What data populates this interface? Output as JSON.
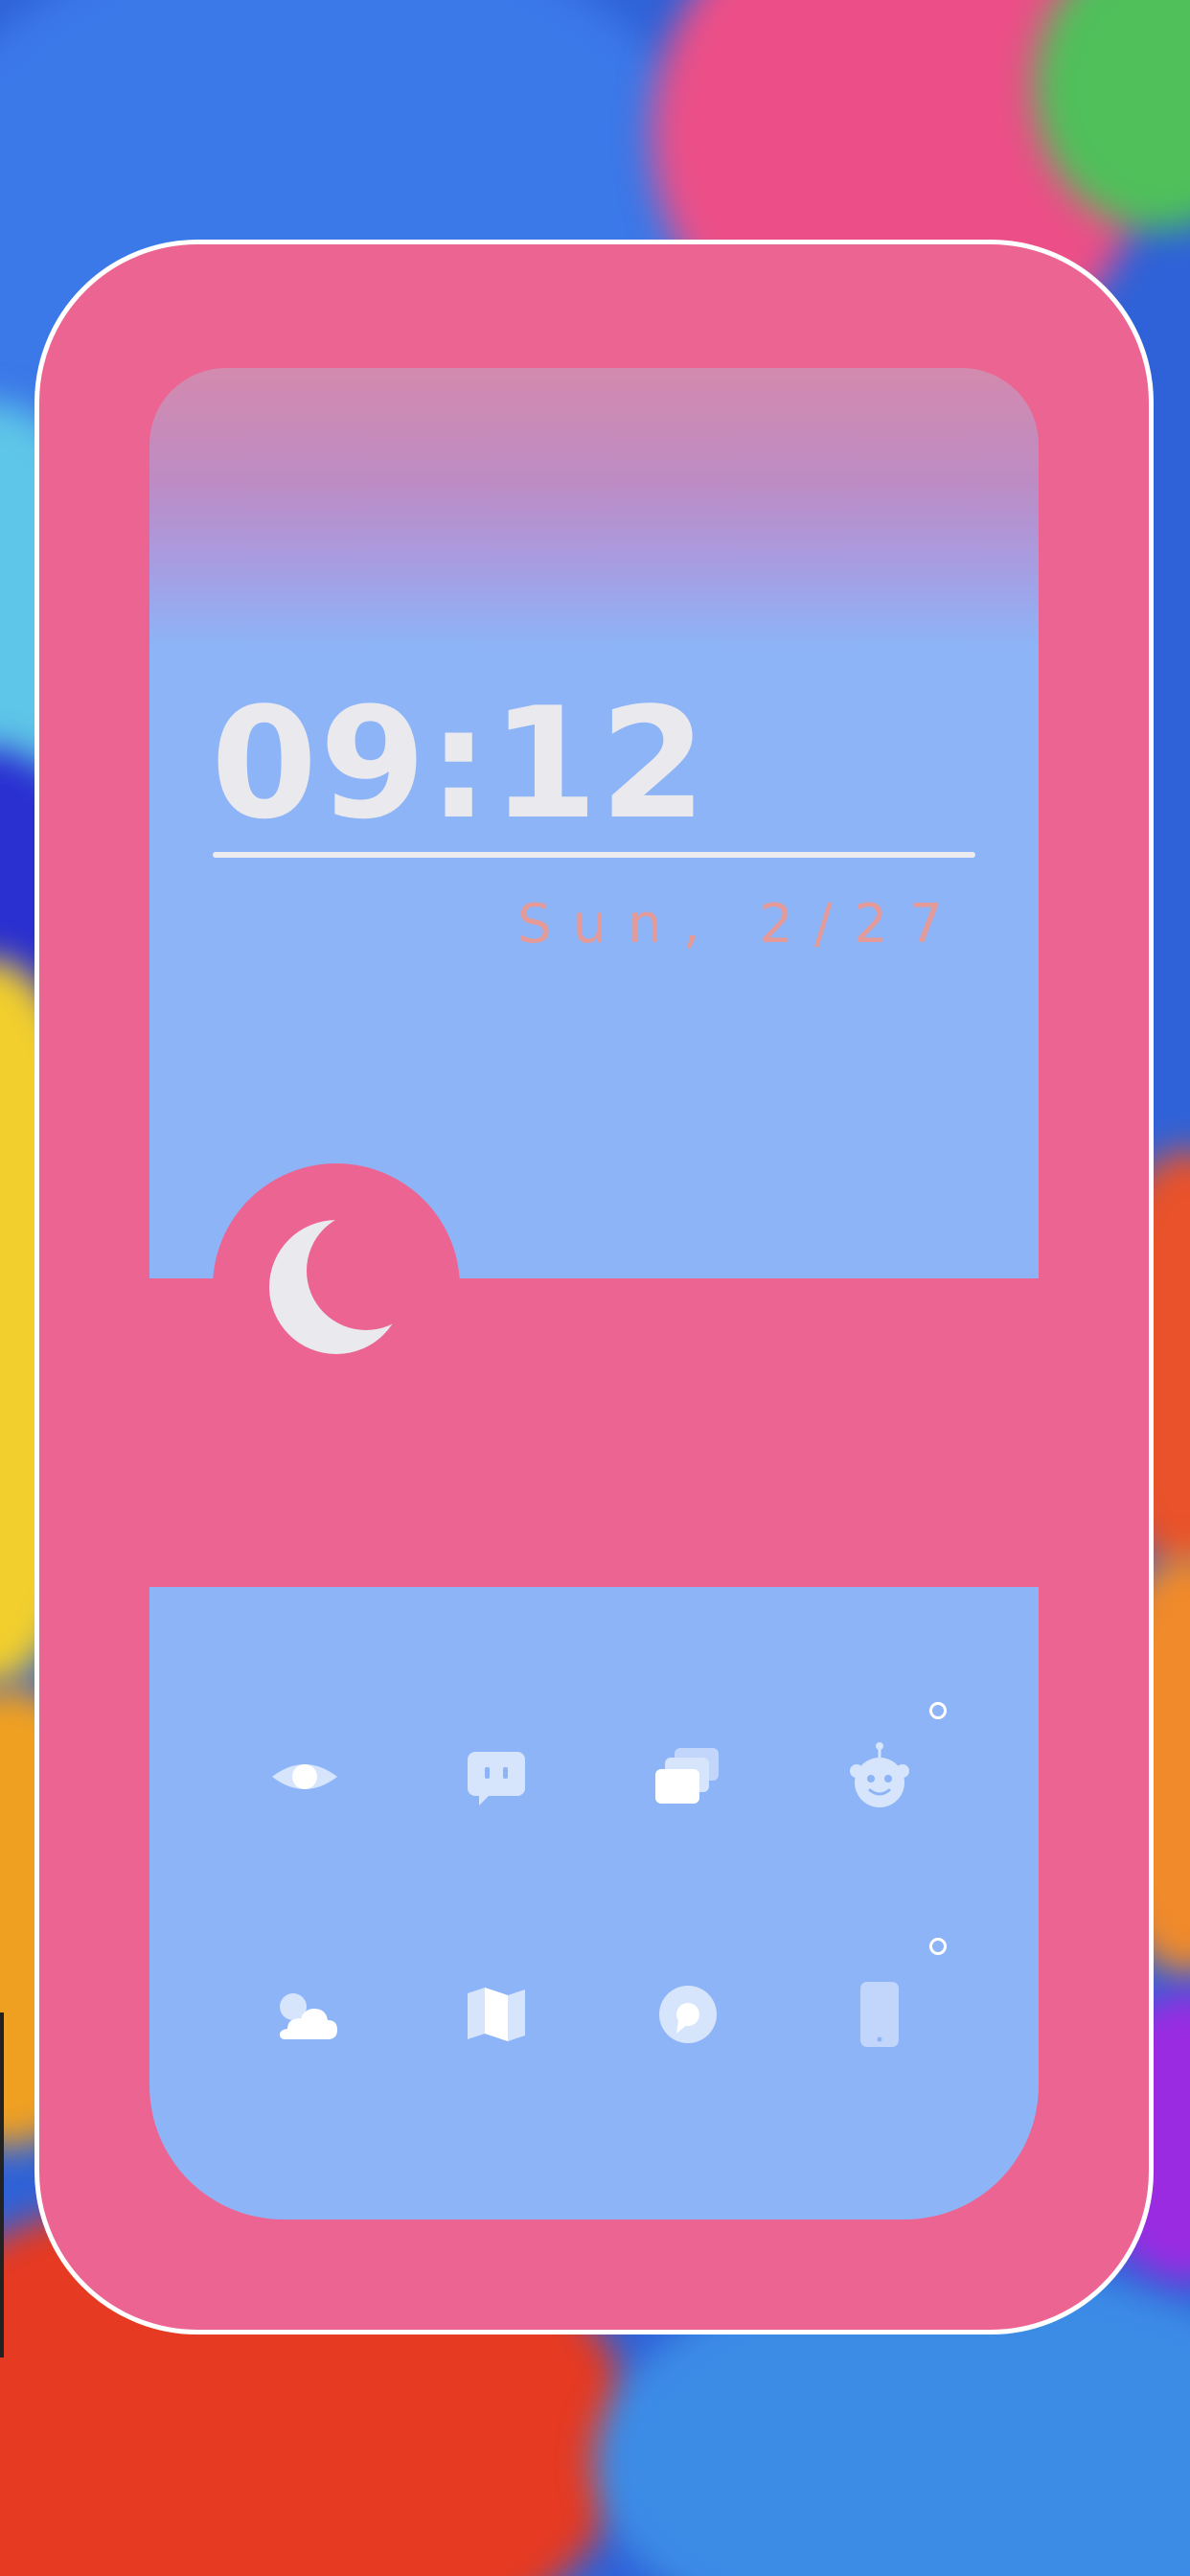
{
  "colors": {
    "card_pink": "#ec6592",
    "panel_blue": "#8db4f7",
    "clock_text": "#e9e9ee",
    "date_text": "#e49a98",
    "icon_tint": "#d6e4fc",
    "border_white": "#ffffff"
  },
  "clock": {
    "time": "09:12",
    "date": "Sun, 2/27"
  },
  "moon_widget": {
    "icon": "moon-icon"
  },
  "apps": {
    "row1": [
      {
        "icon": "eye-icon"
      },
      {
        "icon": "chat-bubble-icon"
      },
      {
        "icon": "stacked-cards-icon"
      },
      {
        "icon": "robot-face-icon",
        "badge": true
      }
    ],
    "row2": [
      {
        "icon": "weather-cloud-icon"
      },
      {
        "icon": "map-icon"
      },
      {
        "icon": "chat-ring-icon"
      },
      {
        "icon": "phone-icon",
        "badge": true
      }
    ]
  }
}
